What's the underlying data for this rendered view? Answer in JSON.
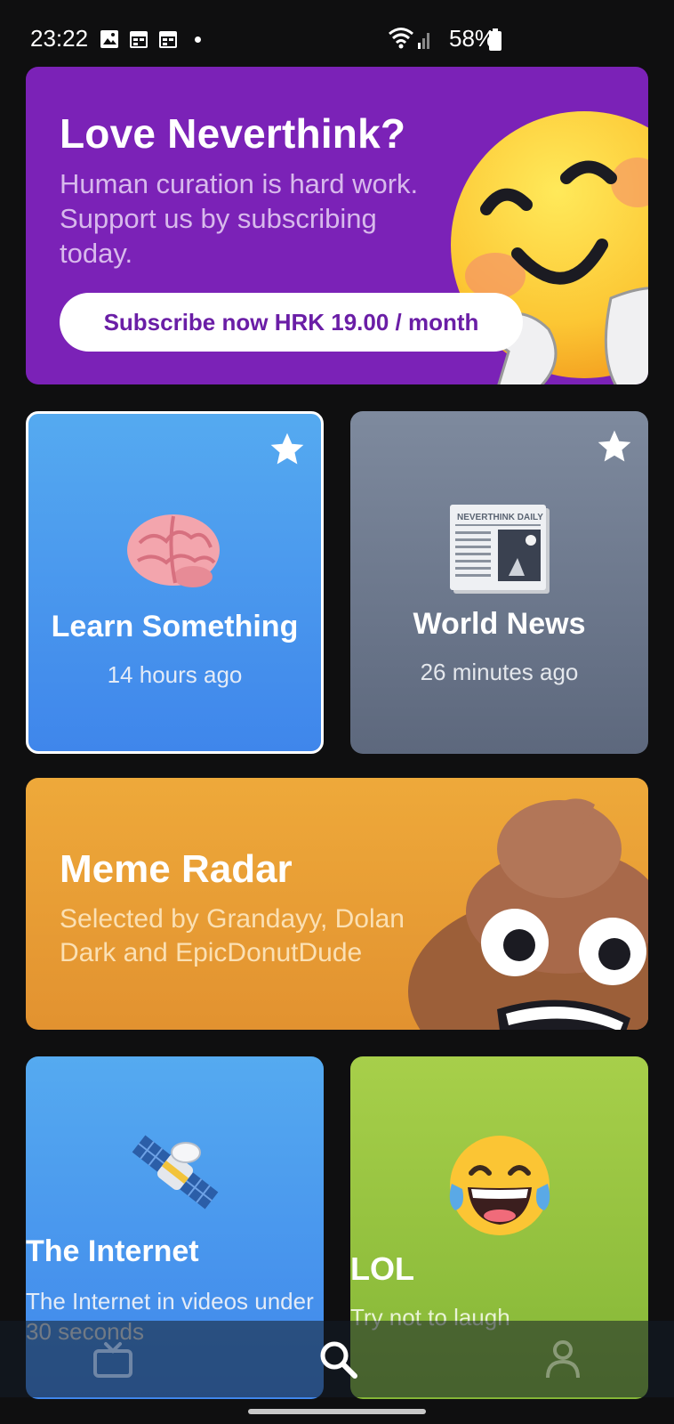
{
  "status_bar": {
    "time": "23:22",
    "battery": "58%",
    "icons": [
      "gallery-icon",
      "calendar-icon",
      "calendar-icon",
      "notification-dot",
      "wifi-icon",
      "signal-icon",
      "battery-icon"
    ]
  },
  "promo": {
    "title": "Love Neverthink?",
    "text": "Human curation is hard work. Support us by subscribing today.",
    "button_label": "Subscribe now HRK 19.00 / month",
    "emoji": "smiling-face-hugging-icon",
    "color": "#7b22b7"
  },
  "channels": [
    {
      "title": "Learn Something",
      "subtitle": "14 hours ago",
      "starred": true,
      "selected": true,
      "emoji": "brain-icon",
      "color": "#4a97ee"
    },
    {
      "title": "World News",
      "subtitle": "26 minutes ago",
      "starred": true,
      "selected": false,
      "emoji": "newspaper-icon",
      "newspaper_masthead": "NEVERTHINK DAILY",
      "color": "#6f7a8e"
    },
    {
      "title": "Meme Radar",
      "subtitle": "Selected by Grandayy, Dolan Dark and EpicDonutDude",
      "emoji": "poop-icon",
      "color": "#e89c35"
    },
    {
      "title": "The Internet",
      "subtitle": "The Internet in videos under 30 seconds",
      "emoji": "satellite-icon",
      "color": "#4a97ee"
    },
    {
      "title": "LOL",
      "subtitle": "Try not to laugh",
      "emoji": "tears-of-joy-icon",
      "color": "#96c33f"
    }
  ],
  "bottom_nav": {
    "items": [
      "tv-icon",
      "search-icon",
      "profile-icon"
    ],
    "active": "search-icon"
  }
}
